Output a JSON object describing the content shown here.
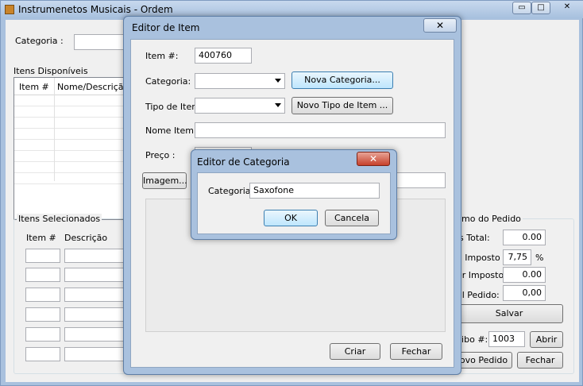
{
  "main": {
    "title": "Instrumenetos Musicais - Ordem",
    "categoria_label": "Categoria :",
    "itens_disponiveis_label": "Itens Disponíveis",
    "col_item": "Item #",
    "col_nome": "Nome/Descrição It",
    "itens_selecionados_label": "Itens Selecionados",
    "sel_col_item": "Item #",
    "sel_col_descricao": "Descrição",
    "resumo_label": "mo do Pedido",
    "total_label": "is Total:",
    "total_value": "0.00",
    "imposto_label": "a Imposto",
    "imposto_value": "7,75",
    "imposto_unit": "%",
    "valor_imposto_label": "or Imposto",
    "valor_imposto_value": "0.00",
    "total_pedido_label": "al Pedido:",
    "total_pedido_value": "0,00",
    "salvar_label": "Salvar",
    "recibo_label": "cibo #:",
    "recibo_value": "1003",
    "abrir_label": "Abrir",
    "novo_pedido_label": "ovo Pedido",
    "fechar_label": "Fechar",
    "caption_min": "▭",
    "caption_max": "□",
    "caption_close": "✕"
  },
  "editor_item": {
    "title": "Editor de Item",
    "close_glyph": "✕",
    "item_label": "Item #:",
    "item_value": "400760",
    "categoria_label": "Categoria:",
    "nova_categoria_label": "Nova Categoria...",
    "tipo_label": "Tipo de Item:",
    "novo_tipo_label": "Novo Tipo de  Item ...",
    "nome_label": "Nome Item:",
    "preco_label": "Preço :",
    "imagem_label": "Imagem...",
    "criar_label": "Criar",
    "fechar_label": "Fechar"
  },
  "editor_categoria": {
    "title": "Editor de Categoria",
    "close_glyph": "✕",
    "categoria_label": "Categoria:",
    "categoria_value": "Saxofone",
    "ok_label": "OK",
    "cancela_label": "Cancela"
  }
}
